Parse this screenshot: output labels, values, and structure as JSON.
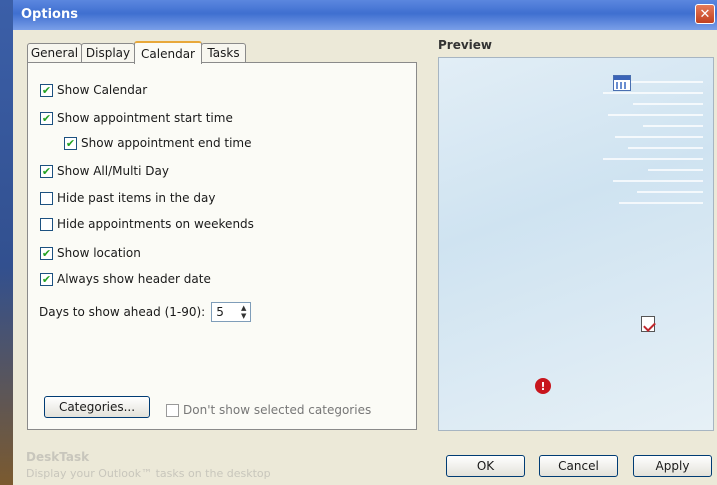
{
  "window": {
    "title": "Options",
    "close_symbol": "✕"
  },
  "tabs": [
    {
      "label": "General"
    },
    {
      "label": "Display"
    },
    {
      "label": "Calendar",
      "active": true
    },
    {
      "label": "Tasks"
    }
  ],
  "calendar": {
    "options": [
      {
        "label": "Show Calendar",
        "checked": true
      },
      {
        "label": "Show appointment start time",
        "checked": true
      },
      {
        "label": "Show appointment end time",
        "checked": true
      },
      {
        "label": "Show All/Multi Day",
        "checked": true
      },
      {
        "label": "Hide past items in the day",
        "checked": false
      },
      {
        "label": "Hide appointments on weekends",
        "checked": false
      },
      {
        "label": "Show location",
        "checked": true
      },
      {
        "label": "Always show header date",
        "checked": true
      }
    ],
    "days_ahead_label": "Days to show ahead (1-90):",
    "days_ahead_value": "5",
    "categories_button": "Categories...",
    "dont_show_categories": {
      "label": "Don't show selected categories",
      "checked": false
    }
  },
  "preview": {
    "label": "Preview",
    "icons": [
      "calendar-icon",
      "task-icon",
      "alert-icon"
    ]
  },
  "footer": {
    "desktask_title": "DeskTask",
    "desktask_desc": "Display your Outlook™ tasks on the desktop",
    "ok": "OK",
    "cancel": "Cancel",
    "apply": "Apply"
  },
  "colors": {
    "titlebar": "#3f6fd0",
    "tab_accent": "#e8a83a",
    "check": "#21a121"
  }
}
